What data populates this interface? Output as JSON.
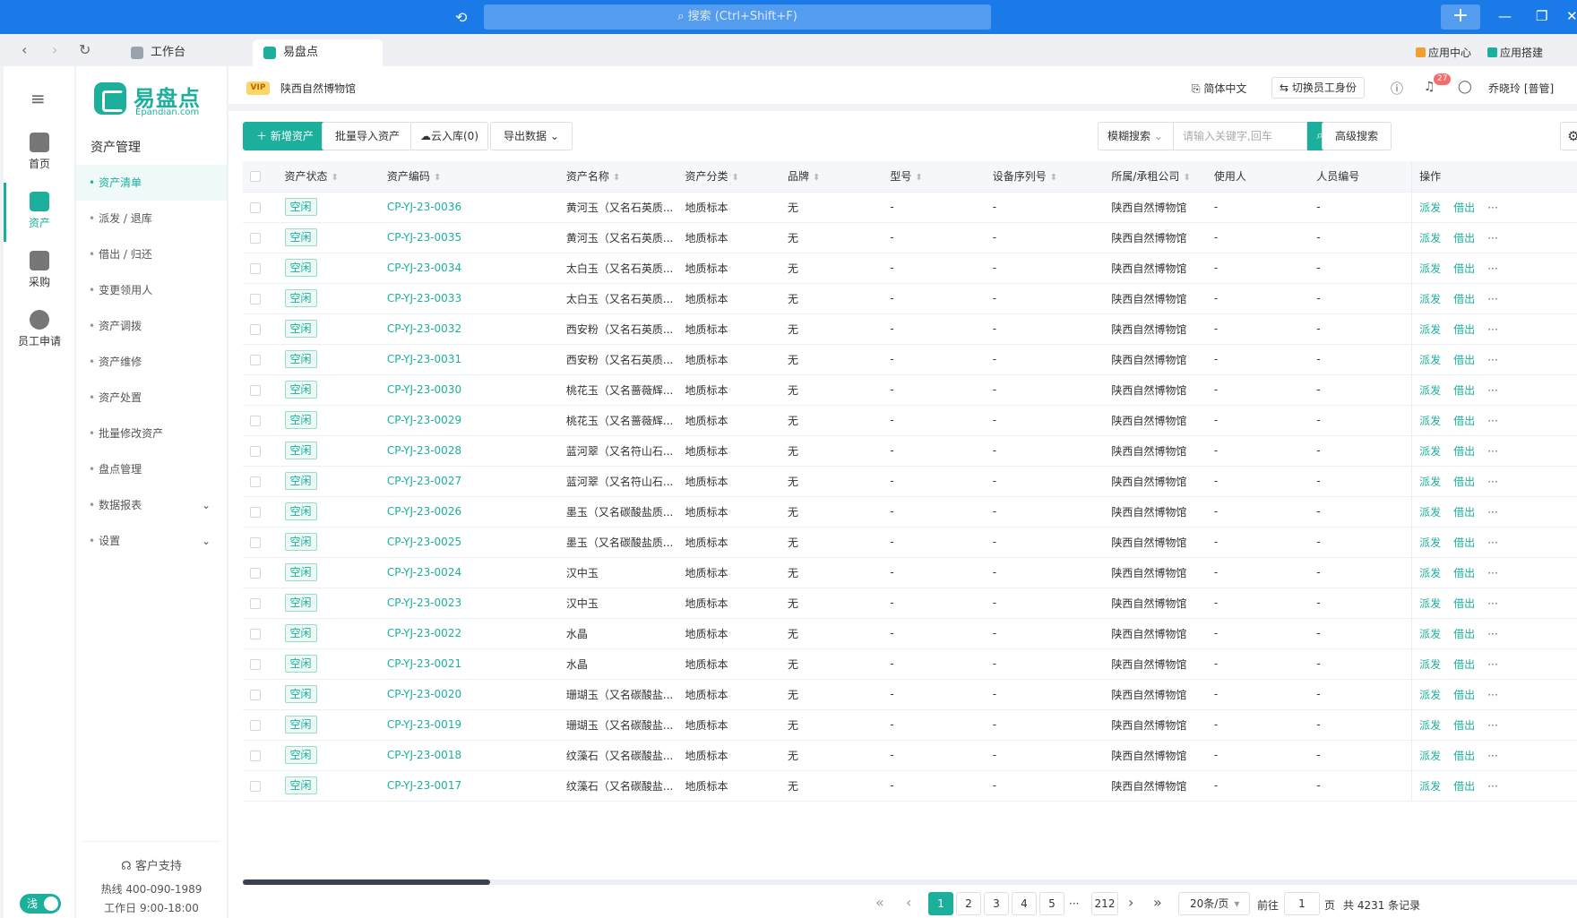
{
  "titlebar": {
    "search_placeholder": "搜索 (Ctrl+Shift+F)"
  },
  "tabbar": {
    "tabs": [
      {
        "label": "工作台"
      },
      {
        "label": "易盘点"
      }
    ],
    "app_center": "应用中心",
    "app_build": "应用搭建"
  },
  "rail": {
    "items": [
      {
        "label": "首页"
      },
      {
        "label": "资产"
      },
      {
        "label": "采购"
      },
      {
        "label": "员工申请"
      }
    ],
    "theme_toggle": "浅"
  },
  "logo": {
    "name": "易盘点",
    "domain": "Epandian.com"
  },
  "sidebar": {
    "section_title": "资产管理",
    "items": [
      {
        "label": "资产清单"
      },
      {
        "label": "派发 / 退库"
      },
      {
        "label": "借出 / 归还"
      },
      {
        "label": "变更领用人"
      },
      {
        "label": "资产调拨"
      },
      {
        "label": "资产维修"
      },
      {
        "label": "资产处置"
      },
      {
        "label": "批量修改资产"
      },
      {
        "label": "盘点管理"
      },
      {
        "label": "数据报表"
      },
      {
        "label": "设置"
      }
    ],
    "support": {
      "title": "客户支持",
      "hotline": "热线 400-090-1989",
      "hours": "工作日 9:00-18:00"
    }
  },
  "header": {
    "vip": "VIP",
    "org": "陕西自然博物馆",
    "language": "简体中文",
    "switch_role": "切换员工身份",
    "notification_count": "27",
    "user": "乔晓玲 [普管]"
  },
  "toolbar": {
    "add": "新增资产",
    "batch_import": "批量导入资产",
    "cloud_in": "云入库(0)",
    "export": "导出数据",
    "search_mode": "模糊搜索",
    "search_placeholder": "请输入关键字,回车",
    "advanced": "高级搜索"
  },
  "table": {
    "columns": [
      "资产状态",
      "资产编码",
      "资产名称",
      "资产分类",
      "品牌",
      "型号",
      "设备序列号",
      "所属/承租公司",
      "使用人",
      "人员编号",
      "操作"
    ],
    "actions": {
      "dispatch": "派发",
      "lend": "借出",
      "more": "···"
    },
    "rows": [
      {
        "status": "空闲",
        "code": "CP-YJ-23-0036",
        "name": "黄河玉（又名石英质...",
        "category": "地质标本",
        "brand": "无",
        "model": "-",
        "serial": "-",
        "company": "陕西自然博物馆",
        "user": "-",
        "user_no": "-"
      },
      {
        "status": "空闲",
        "code": "CP-YJ-23-0035",
        "name": "黄河玉（又名石英质...",
        "category": "地质标本",
        "brand": "无",
        "model": "-",
        "serial": "-",
        "company": "陕西自然博物馆",
        "user": "-",
        "user_no": "-"
      },
      {
        "status": "空闲",
        "code": "CP-YJ-23-0034",
        "name": "太白玉（又名石英质...",
        "category": "地质标本",
        "brand": "无",
        "model": "-",
        "serial": "-",
        "company": "陕西自然博物馆",
        "user": "-",
        "user_no": "-"
      },
      {
        "status": "空闲",
        "code": "CP-YJ-23-0033",
        "name": "太白玉（又名石英质...",
        "category": "地质标本",
        "brand": "无",
        "model": "-",
        "serial": "-",
        "company": "陕西自然博物馆",
        "user": "-",
        "user_no": "-"
      },
      {
        "status": "空闲",
        "code": "CP-YJ-23-0032",
        "name": "西安粉（又名石英质...",
        "category": "地质标本",
        "brand": "无",
        "model": "-",
        "serial": "-",
        "company": "陕西自然博物馆",
        "user": "-",
        "user_no": "-"
      },
      {
        "status": "空闲",
        "code": "CP-YJ-23-0031",
        "name": "西安粉（又名石英质...",
        "category": "地质标本",
        "brand": "无",
        "model": "-",
        "serial": "-",
        "company": "陕西自然博物馆",
        "user": "-",
        "user_no": "-"
      },
      {
        "status": "空闲",
        "code": "CP-YJ-23-0030",
        "name": "桃花玉（又名蔷薇辉...",
        "category": "地质标本",
        "brand": "无",
        "model": "-",
        "serial": "-",
        "company": "陕西自然博物馆",
        "user": "-",
        "user_no": "-"
      },
      {
        "status": "空闲",
        "code": "CP-YJ-23-0029",
        "name": "桃花玉（又名蔷薇辉...",
        "category": "地质标本",
        "brand": "无",
        "model": "-",
        "serial": "-",
        "company": "陕西自然博物馆",
        "user": "-",
        "user_no": "-"
      },
      {
        "status": "空闲",
        "code": "CP-YJ-23-0028",
        "name": "蓝河翠（又名符山石...",
        "category": "地质标本",
        "brand": "无",
        "model": "-",
        "serial": "-",
        "company": "陕西自然博物馆",
        "user": "-",
        "user_no": "-"
      },
      {
        "status": "空闲",
        "code": "CP-YJ-23-0027",
        "name": "蓝河翠（又名符山石...",
        "category": "地质标本",
        "brand": "无",
        "model": "-",
        "serial": "-",
        "company": "陕西自然博物馆",
        "user": "-",
        "user_no": "-"
      },
      {
        "status": "空闲",
        "code": "CP-YJ-23-0026",
        "name": "墨玉（又名碳酸盐质...",
        "category": "地质标本",
        "brand": "无",
        "model": "-",
        "serial": "-",
        "company": "陕西自然博物馆",
        "user": "-",
        "user_no": "-"
      },
      {
        "status": "空闲",
        "code": "CP-YJ-23-0025",
        "name": "墨玉（又名碳酸盐质...",
        "category": "地质标本",
        "brand": "无",
        "model": "-",
        "serial": "-",
        "company": "陕西自然博物馆",
        "user": "-",
        "user_no": "-"
      },
      {
        "status": "空闲",
        "code": "CP-YJ-23-0024",
        "name": "汉中玉",
        "category": "地质标本",
        "brand": "无",
        "model": "-",
        "serial": "-",
        "company": "陕西自然博物馆",
        "user": "-",
        "user_no": "-"
      },
      {
        "status": "空闲",
        "code": "CP-YJ-23-0023",
        "name": "汉中玉",
        "category": "地质标本",
        "brand": "无",
        "model": "-",
        "serial": "-",
        "company": "陕西自然博物馆",
        "user": "-",
        "user_no": "-"
      },
      {
        "status": "空闲",
        "code": "CP-YJ-23-0022",
        "name": "水晶",
        "category": "地质标本",
        "brand": "无",
        "model": "-",
        "serial": "-",
        "company": "陕西自然博物馆",
        "user": "-",
        "user_no": "-"
      },
      {
        "status": "空闲",
        "code": "CP-YJ-23-0021",
        "name": "水晶",
        "category": "地质标本",
        "brand": "无",
        "model": "-",
        "serial": "-",
        "company": "陕西自然博物馆",
        "user": "-",
        "user_no": "-"
      },
      {
        "status": "空闲",
        "code": "CP-YJ-23-0020",
        "name": "珊瑚玉（又名碳酸盐...",
        "category": "地质标本",
        "brand": "无",
        "model": "-",
        "serial": "-",
        "company": "陕西自然博物馆",
        "user": "-",
        "user_no": "-"
      },
      {
        "status": "空闲",
        "code": "CP-YJ-23-0019",
        "name": "珊瑚玉（又名碳酸盐...",
        "category": "地质标本",
        "brand": "无",
        "model": "-",
        "serial": "-",
        "company": "陕西自然博物馆",
        "user": "-",
        "user_no": "-"
      },
      {
        "status": "空闲",
        "code": "CP-YJ-23-0018",
        "name": "纹藻石（又名碳酸盐...",
        "category": "地质标本",
        "brand": "无",
        "model": "-",
        "serial": "-",
        "company": "陕西自然博物馆",
        "user": "-",
        "user_no": "-"
      },
      {
        "status": "空闲",
        "code": "CP-YJ-23-0017",
        "name": "纹藻石（又名碳酸盐...",
        "category": "地质标本",
        "brand": "无",
        "model": "-",
        "serial": "-",
        "company": "陕西自然博物馆",
        "user": "-",
        "user_no": "-"
      }
    ]
  },
  "pagination": {
    "pages": [
      "1",
      "2",
      "3",
      "4",
      "5"
    ],
    "ellipsis": "···",
    "last": "212",
    "page_size": "20条/页",
    "goto_prefix": "前往",
    "goto_value": "1",
    "goto_suffix": "页",
    "total": "共 4231 条记录"
  },
  "colors": {
    "accent": "#1cb09c",
    "titlebar": "#1a7be8",
    "badge": "#f56c6c"
  },
  "icons": {
    "history": "history-icon",
    "search": "search-icon",
    "bell": "bell-icon",
    "gear": "gear-icon"
  }
}
